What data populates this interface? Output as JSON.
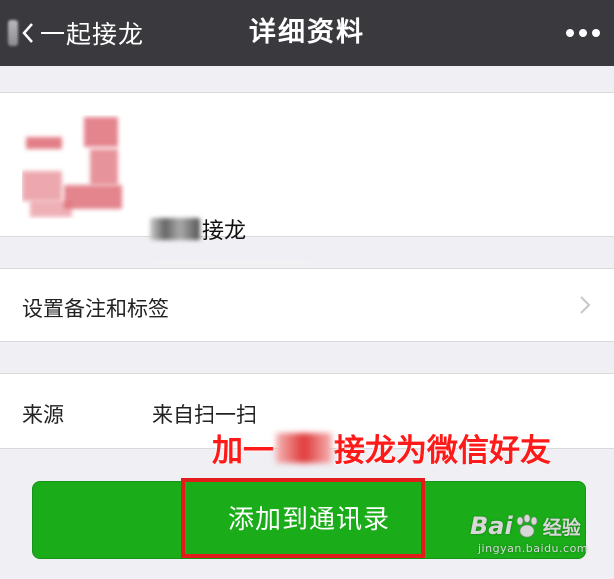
{
  "nav": {
    "back_label": "一起接龙",
    "title": "详细资料",
    "more_icon": "more-dots-icon"
  },
  "profile": {
    "name_visible": "接龙"
  },
  "remark_row": {
    "label": "设置备注和标签"
  },
  "source_row": {
    "label": "来源",
    "value": "来自扫一扫"
  },
  "overlay_caption": {
    "prefix": "加一",
    "suffix": "接龙为微信好友"
  },
  "add_button": {
    "label": "添加到通讯录"
  },
  "watermark": {
    "brand_a": "Bai",
    "brand_b": "经验",
    "url": "jingyan.baidu.com"
  },
  "colors": {
    "navbar": "#3a3a3e",
    "button_green": "#1aad19",
    "highlight_red": "#e21b1b",
    "caption_red": "#ff1a1a",
    "background": "#efeff4"
  }
}
